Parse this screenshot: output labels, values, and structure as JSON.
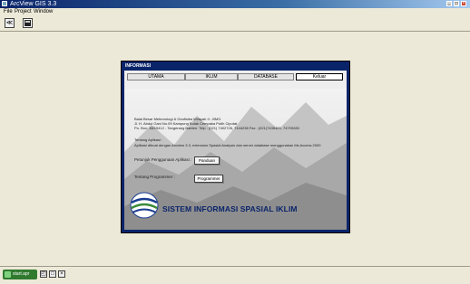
{
  "window": {
    "title": "ArcView GIS 3.3"
  },
  "menu": [
    "File",
    "Project",
    "Window"
  ],
  "dialog": {
    "title": "INFORMASI",
    "tabs": [
      "UTAMA",
      "IKLIM",
      "DATABASE",
      "Keluar"
    ],
    "address_lines": [
      "Balai Besar Meteorologi & Geofisika Wilayah II - BMG",
      "Jl. H. Abdul Gani No.09 Kampung Bulak Cempaka Putih Ciputat",
      "Po. Box: 38/15412 - Tangerang Banten. Telp : (021) 7402726, 7444238 Fax : (021)7435485, 74709283"
    ],
    "about_heading": "Tentang Aplikasi :",
    "about_text": "Aplikasi dibuat dengan Arcview 3.3, extension Spasial Analysis dan server database menggunakan Ms Access 2000",
    "guide_label": "Petunjuk Penggunaan Aplikasi :",
    "guide_button": "Panduan",
    "programmer_label": "Tentang Programmer :",
    "programmer_button": "Programmer",
    "brand_text": "SISTEM INFORMASI SPASIAL IKLIM"
  },
  "taskbar": {
    "start_label": "start.apr"
  },
  "colors": {
    "title_blue": "#0a246a",
    "workspace": "#ece9d8",
    "start_green": "#2f7a2f",
    "brand_blue": "#0a246a"
  }
}
